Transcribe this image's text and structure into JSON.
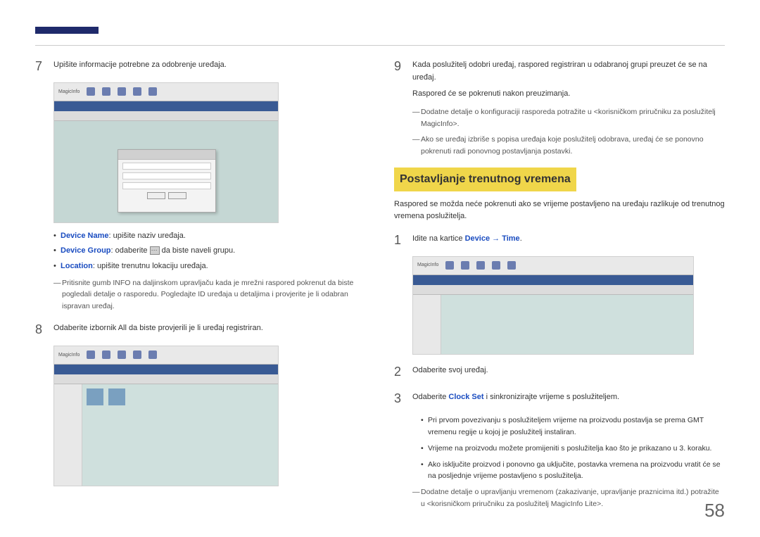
{
  "page_number": "58",
  "left": {
    "step7": {
      "num": "7",
      "text": "Upišite informacije potrebne za odobrenje uređaja.",
      "screenshot_logo": "MagicInfo",
      "bullets": {
        "b1_label": "Device Name",
        "b1_text": ": upišite naziv uređaja.",
        "b2_label": "Device Group",
        "b2_text_a": ": odaberite ",
        "b2_text_b": " da biste naveli grupu.",
        "b3_label": "Location",
        "b3_text": ": upišite trenutnu lokaciju uređaja."
      },
      "note": "Pritisnite gumb INFO na daljinskom upravljaču kada je mrežni raspored pokrenut da biste pogledali detalje o rasporedu. Pogledajte ID uređaja u detaljima i provjerite je li odabran ispravan uređaj."
    },
    "step8": {
      "num": "8",
      "text": "Odaberite izbornik All da biste provjerili je li uređaj registriran.",
      "screenshot_logo": "MagicInfo"
    }
  },
  "right": {
    "step9": {
      "num": "9",
      "line1": "Kada poslužitelj odobri uređaj, raspored registriran u odabranoj grupi preuzet će se na uređaj.",
      "line2": "Raspored će se pokrenuti nakon preuzimanja.",
      "note1": "Dodatne detalje o konfiguraciji rasporeda potražite u <korisničkom priručniku za poslužitelj MagicInfo>.",
      "note2": "Ako se uređaj izbriše s popisa uređaja koje poslužitelj odobrava, uređaj će se ponovno pokrenuti radi ponovnog postavljanja postavki."
    },
    "heading": "Postavljanje trenutnog vremena",
    "intro": "Raspored se možda neće pokrenuti ako se vrijeme postavljeno na uređaju razlikuje od trenutnog vremena poslužitelja.",
    "step1": {
      "num": "1",
      "text_a": "Idite na kartice ",
      "link1": "Device",
      "arrow": " → ",
      "link2": "Time",
      "text_b": ".",
      "screenshot_logo": "MagicInfo"
    },
    "step2": {
      "num": "2",
      "text": "Odaberite svoj uređaj."
    },
    "step3": {
      "num": "3",
      "text_a": "Odaberite ",
      "link": "Clock Set",
      "text_b": " i sinkronizirajte vrijeme s poslužiteljem.",
      "sub1": "Pri prvom povezivanju s poslužiteljem vrijeme na proizvodu postavlja se prema GMT vremenu regije u kojoj je poslužitelj instaliran.",
      "sub2": "Vrijeme na proizvodu možete promijeniti s poslužitelja kao što je prikazano u 3. koraku.",
      "sub3": "Ako isključite proizvod i ponovno ga uključite, postavka vremena na proizvodu vratit će se na posljednje vrijeme postavljeno s poslužitelja.",
      "note": "Dodatne detalje o upravljanju vremenom (zakazivanje, upravljanje praznicima itd.) potražite u <korisničkom priručniku za poslužitelj MagicInfo Lite>."
    }
  }
}
